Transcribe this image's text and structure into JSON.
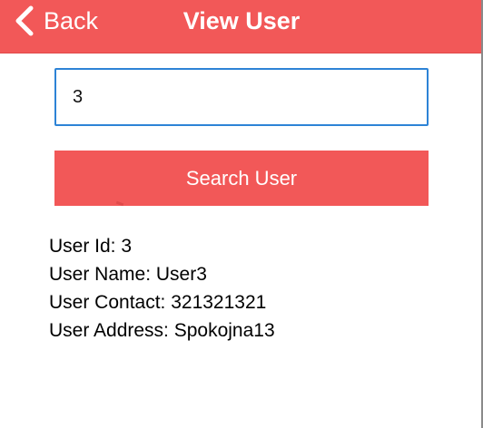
{
  "nav": {
    "back_label": "Back",
    "title": "View User"
  },
  "search": {
    "value": "3",
    "button_label": "Search User"
  },
  "user": {
    "id_line": "User Id: 3",
    "name_line": "User Name: User3",
    "contact_line": "User Contact: 321321321",
    "address_line": "User Address: Spokojna13"
  },
  "colors": {
    "accent": "#f25858",
    "input_border": "#2d83d6"
  },
  "icons": {
    "back": "chevron-left-icon"
  }
}
